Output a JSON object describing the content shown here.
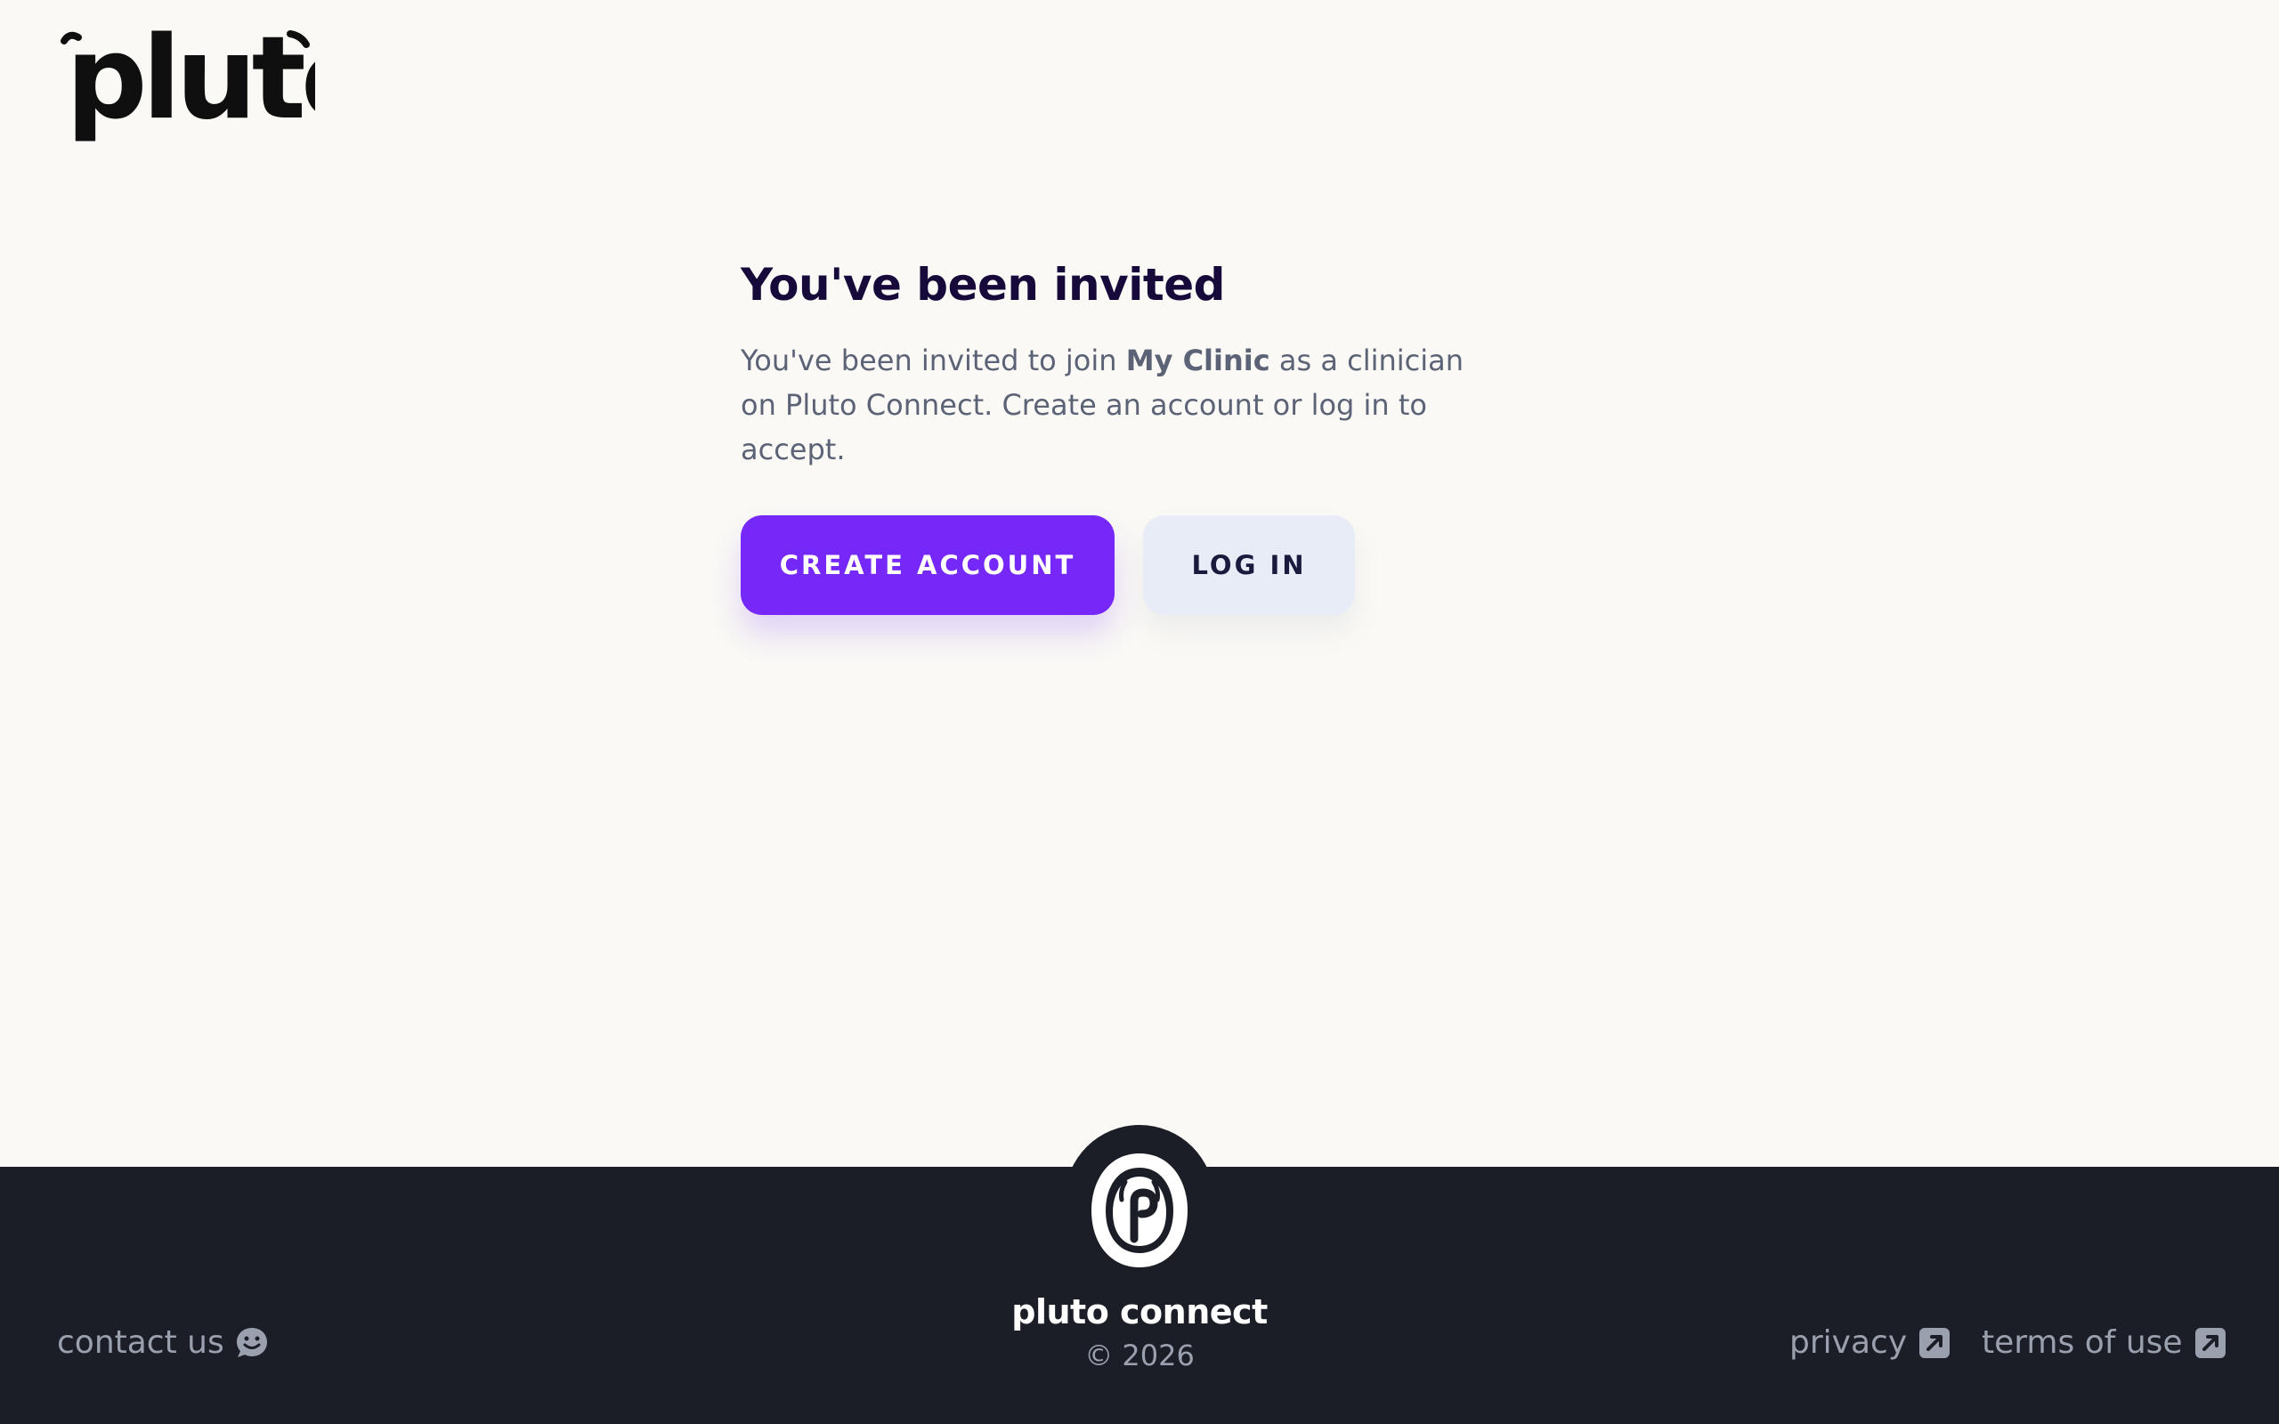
{
  "brand": {
    "logo_text": "pluto"
  },
  "invite": {
    "title": "You've been invited",
    "text_before": "You've been invited to join ",
    "clinic_name": "My Clinic",
    "text_after": " as a clinician on Pluto Connect. Create an account or log in to accept."
  },
  "actions": {
    "create_account_label": "CREATE ACCOUNT",
    "log_in_label": "LOG IN"
  },
  "footer": {
    "brand_name": "pluto connect",
    "copyright": "© 2026",
    "contact_label": "contact us",
    "privacy_label": "privacy",
    "terms_label": "terms of use"
  },
  "icons": {
    "contact": "smiley-chat-icon",
    "privacy": "external-link-icon",
    "terms": "external-link-icon",
    "footer_mark": "pluto-mark-icon"
  },
  "colors": {
    "background": "#faf9f5",
    "primary": "#7528f7",
    "secondary": "#e7ecf7",
    "footer": "#1b1e26",
    "heading": "#170a3b"
  }
}
